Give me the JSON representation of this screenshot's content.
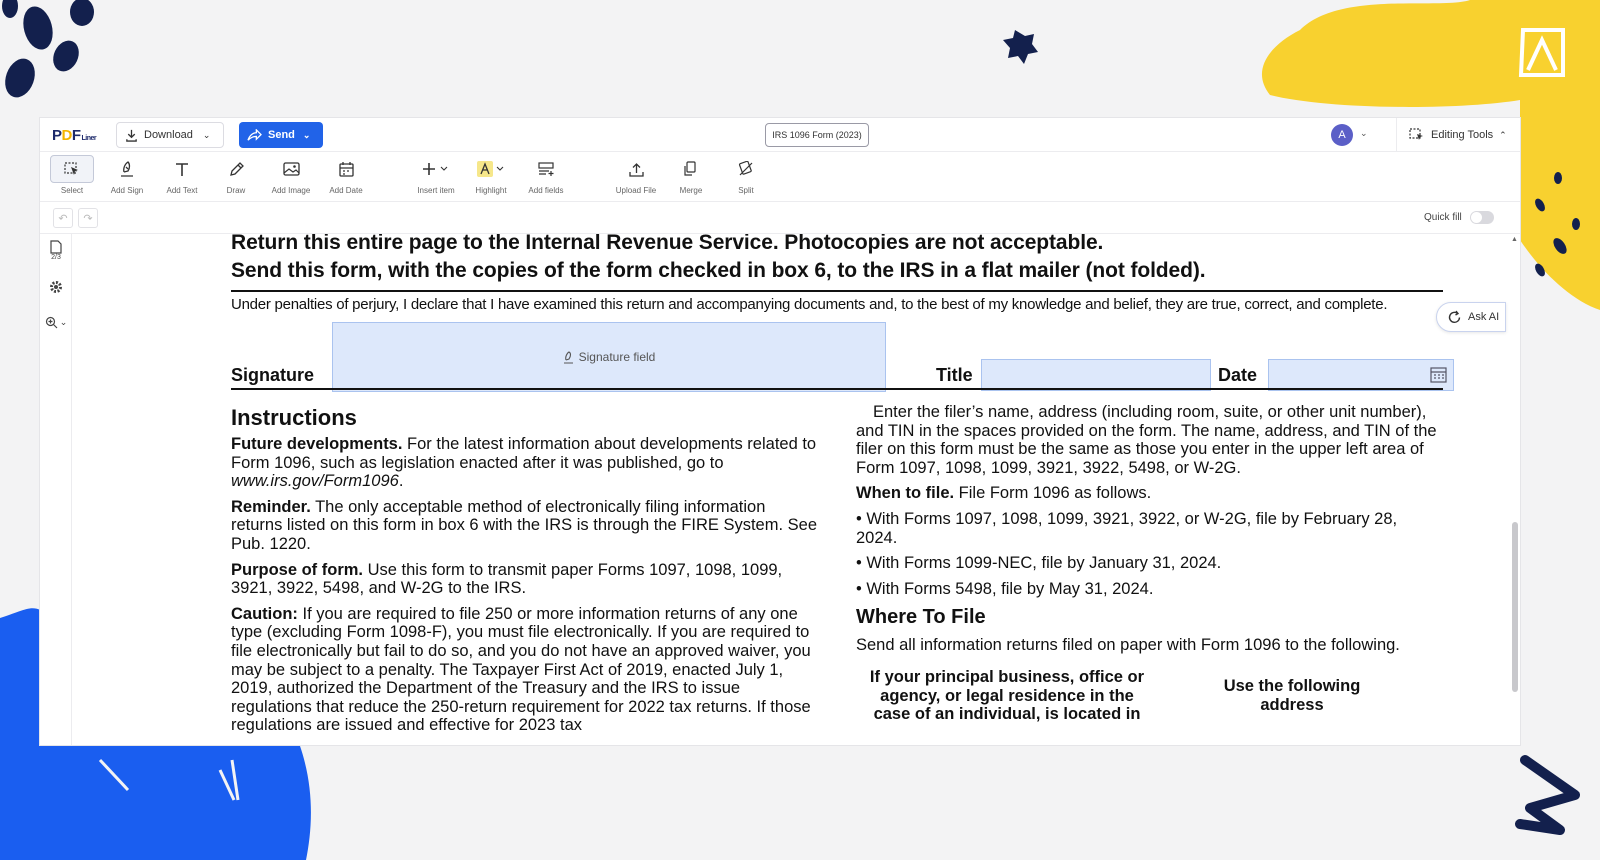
{
  "app": {
    "logo": {
      "p": "P",
      "d": "D",
      "f": "F",
      "sub": "Liner"
    },
    "download_label": "Download",
    "send_label": "Send",
    "document_name": "IRS 1096 Form (2023)",
    "avatar_initial": "A",
    "editing_tools_label": "Editing Tools",
    "quick_fill_label": "Quick fill",
    "ask_ai_label": "Ask AI",
    "page_indicator": "2/3",
    "accent_color": "#2163e8",
    "field_color": "#dde8fb"
  },
  "toolbar": [
    {
      "label": "Select",
      "icon": "select-cursor-icon"
    },
    {
      "label": "Add Sign",
      "icon": "sign-pen-icon"
    },
    {
      "label": "Add Text",
      "icon": "text-icon"
    },
    {
      "label": "Draw",
      "icon": "pencil-icon"
    },
    {
      "label": "Add Image",
      "icon": "image-icon"
    },
    {
      "label": "Add Date",
      "icon": "calendar-icon"
    },
    {
      "label": "Insert item",
      "icon": "plus-icon"
    },
    {
      "label": "Highlight",
      "icon": "highlighter-icon"
    },
    {
      "label": "Add fields",
      "icon": "fields-icon"
    },
    {
      "label": "Upload File",
      "icon": "upload-icon"
    },
    {
      "label": "Merge",
      "icon": "merge-icon"
    },
    {
      "label": "Split",
      "icon": "split-icon"
    }
  ],
  "document": {
    "heading_line1": "Return this entire page to the Internal Revenue Service. Photocopies are not acceptable.",
    "heading_line2": "Send this form, with the copies of the form checked in box 6, to the IRS in a flat mailer (not folded).",
    "perjury": "Under penalties of perjury, I declare that I have examined this return and accompanying documents and, to the best of my knowledge and belief, they are true, correct, and complete.",
    "signature_label": "Signature",
    "signature_field_text": "Signature field",
    "title_label": "Title",
    "date_label": "Date",
    "instructions_heading": "Instructions",
    "left": {
      "future_bold": "Future developments.",
      "future_text": " For the latest information about developments related to Form 1096, such as legislation enacted after it was published, go to ",
      "future_link": "www.irs.gov/Form1096",
      "future_end": ".",
      "reminder_bold": "Reminder.",
      "reminder_text": " The only acceptable method of electronically filing information returns listed on this form in box 6 with the IRS is through the FIRE System. See Pub. 1220.",
      "purpose_bold": "Purpose of form.",
      "purpose_text": " Use this form to transmit paper Forms 1097, 1098, 1099, 3921, 3922, 5498, and W-2G to the IRS.",
      "caution_bold": "Caution:",
      "caution_text": " If you are required to file 250 or more information returns of any one type (excluding Form 1098-F), you must file electronically. If you are required to file electronically but fail to do so, and you do not have an approved waiver, you may be subject to a penalty. The Taxpayer First Act of 2019, enacted July 1, 2019, authorized the Department of the Treasury and the IRS to issue regulations that reduce the 250-return requirement for 2022 tax returns. If those regulations are issued and effective for 2023 tax"
    },
    "right": {
      "filer_text": "Enter the filer’s name, address (including room, suite, or other unit number), and TIN in the spaces provided on the form. The name, address, and TIN of the filer on this form must be the same as those you enter in the upper left area of Form 1097, 1098, 1099, 3921, 3922, 5498, or W-2G.",
      "when_bold": "When to file.",
      "when_text": " File Form 1096 as follows.",
      "bullet1": "• With Forms 1097, 1098, 1099, 3921, 3922, or W-2G, file by February 28, 2024.",
      "bullet2": "• With Forms 1099-NEC, file by January 31, 2024.",
      "bullet3": "• With Forms 5498, file by May 31, 2024.",
      "where_heading": "Where To File",
      "where_text": "Send all information returns filed on paper with Form 1096 to the following.",
      "col_header_left": "If your principal business, office or agency, or legal residence in the case of an individual, is located in",
      "col_header_right": "Use the following address"
    }
  }
}
